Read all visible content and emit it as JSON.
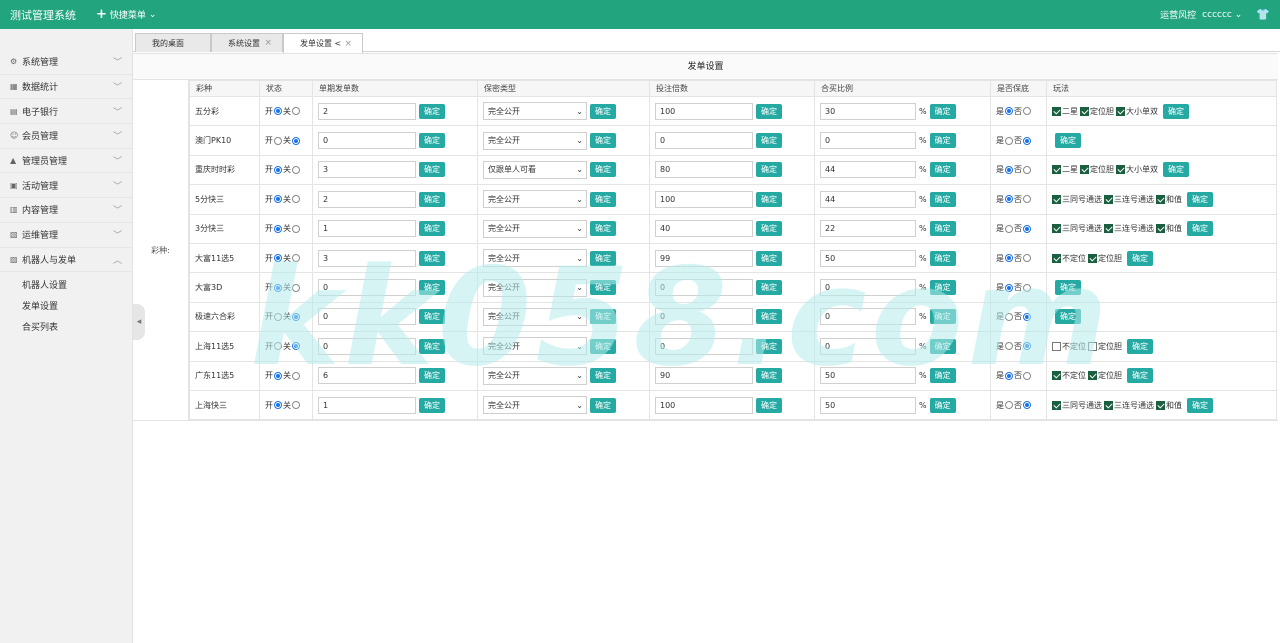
{
  "header": {
    "brand": "测试管理系统",
    "quick_menu": "快捷菜单",
    "user_role": "运营风控",
    "username": "cccccc"
  },
  "sidebar": {
    "items": [
      {
        "label": "系统管理",
        "icon": "gear-icon",
        "glyph": "⚙"
      },
      {
        "label": "数据统计",
        "icon": "chart-icon",
        "glyph": "▦"
      },
      {
        "label": "电子银行",
        "icon": "bank-icon",
        "glyph": "▤"
      },
      {
        "label": "会员管理",
        "icon": "user-icon",
        "glyph": "☺"
      },
      {
        "label": "管理员管理",
        "icon": "admin-icon",
        "glyph": "▲"
      },
      {
        "label": "活动管理",
        "icon": "calendar-icon",
        "glyph": "▣"
      },
      {
        "label": "内容管理",
        "icon": "content-icon",
        "glyph": "▥"
      },
      {
        "label": "运维管理",
        "icon": "ops-icon",
        "glyph": "▧"
      },
      {
        "label": "机器人与发单",
        "icon": "robot-icon",
        "glyph": "▨"
      }
    ],
    "subitems": [
      "机器人设置",
      "发单设置",
      "合买列表"
    ]
  },
  "tabs": [
    "我的桌面",
    "系统设置",
    "发单设置 <"
  ],
  "panel": {
    "title": "发单设置",
    "left_label": "彩种:",
    "columns": [
      "彩种",
      "状态",
      "单期发单数",
      "保密类型",
      "投注倍数",
      "合买比例",
      "是否保底",
      "玩法"
    ],
    "on_label": "开",
    "off_label": "关",
    "yes_label": "是",
    "no_label": "否",
    "confirm": "确定",
    "percent": "%"
  },
  "rows": [
    {
      "name": "五分彩",
      "status_on": true,
      "count": "2",
      "secrecy": "完全公开",
      "multiple": "100",
      "ratio": "30",
      "guarantee": true,
      "plays": [
        {
          "label": "二星",
          "checked": true
        },
        {
          "label": "定位胆",
          "checked": true
        },
        {
          "label": "大小单双",
          "checked": true
        }
      ]
    },
    {
      "name": "澳门PK10",
      "status_on": false,
      "count": "0",
      "secrecy": "完全公开",
      "multiple": "0",
      "ratio": "0",
      "guarantee": false,
      "plays": []
    },
    {
      "name": "重庆时时彩",
      "status_on": true,
      "count": "3",
      "secrecy": "仅跟单人可看",
      "multiple": "80",
      "ratio": "44",
      "guarantee": true,
      "plays": [
        {
          "label": "二星",
          "checked": true
        },
        {
          "label": "定位胆",
          "checked": true
        },
        {
          "label": "大小单双",
          "checked": true
        }
      ]
    },
    {
      "name": "5分快三",
      "status_on": true,
      "count": "2",
      "secrecy": "完全公开",
      "multiple": "100",
      "ratio": "44",
      "guarantee": true,
      "plays": [
        {
          "label": "三同号通选",
          "checked": true
        },
        {
          "label": "三连号通选",
          "checked": true
        },
        {
          "label": "和值",
          "checked": true
        }
      ]
    },
    {
      "name": "3分快三",
      "status_on": true,
      "count": "1",
      "secrecy": "完全公开",
      "multiple": "40",
      "ratio": "22",
      "guarantee": false,
      "plays": [
        {
          "label": "三同号通选",
          "checked": true
        },
        {
          "label": "三连号通选",
          "checked": true
        },
        {
          "label": "和值",
          "checked": true
        }
      ]
    },
    {
      "name": "大富11选5",
      "status_on": true,
      "count": "3",
      "secrecy": "完全公开",
      "multiple": "99",
      "ratio": "50",
      "guarantee": true,
      "plays": [
        {
          "label": "不定位",
          "checked": true
        },
        {
          "label": "定位胆",
          "checked": true
        }
      ]
    },
    {
      "name": "大富3D",
      "status_on": true,
      "count": "0",
      "secrecy": "完全公开",
      "multiple": "0",
      "ratio": "0",
      "guarantee": true,
      "plays": []
    },
    {
      "name": "极速六合彩",
      "status_on": false,
      "count": "0",
      "secrecy": "完全公开",
      "multiple": "0",
      "ratio": "0",
      "guarantee": false,
      "plays": []
    },
    {
      "name": "上海11选5",
      "status_on": false,
      "count": "0",
      "secrecy": "完全公开",
      "multiple": "0",
      "ratio": "0",
      "guarantee": false,
      "plays": [
        {
          "label": "不定位",
          "checked": false
        },
        {
          "label": "定位胆",
          "checked": false
        }
      ]
    },
    {
      "name": "广东11选5",
      "status_on": true,
      "count": "6",
      "secrecy": "完全公开",
      "multiple": "90",
      "ratio": "50",
      "guarantee": true,
      "plays": [
        {
          "label": "不定位",
          "checked": true
        },
        {
          "label": "定位胆",
          "checked": true
        }
      ]
    },
    {
      "name": "上海快三",
      "status_on": true,
      "count": "1",
      "secrecy": "完全公开",
      "multiple": "100",
      "ratio": "50",
      "guarantee": false,
      "plays": [
        {
          "label": "三同号通选",
          "checked": true
        },
        {
          "label": "三连号通选",
          "checked": true
        },
        {
          "label": "和值",
          "checked": true
        }
      ]
    }
  ],
  "watermark": "kk058.com"
}
